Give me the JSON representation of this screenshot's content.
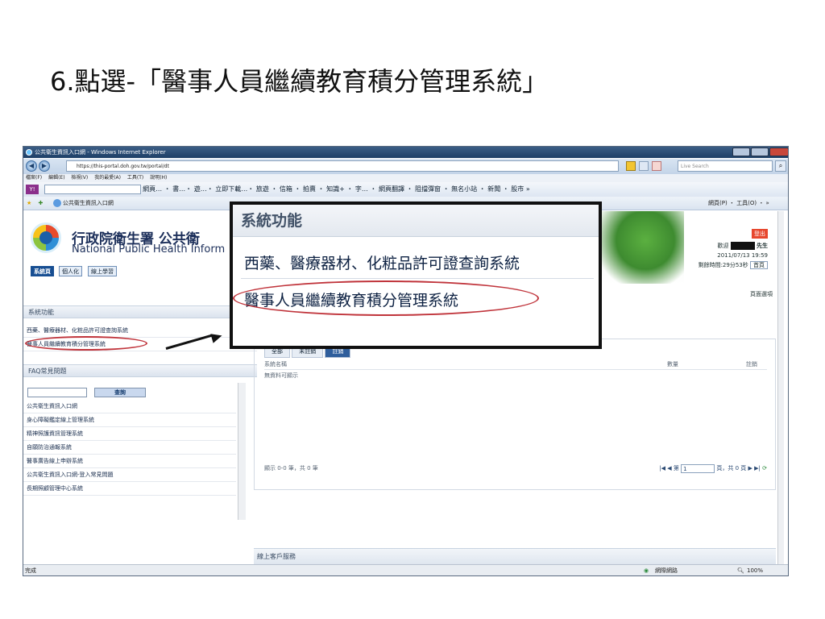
{
  "slide": {
    "title": "6.點選-「醫事人員繼續教育積分管理系統」"
  },
  "browser": {
    "window_title": "公共衛生資訊入口網 - Windows Internet Explorer",
    "url": "https://this-portal.doh.gov.tw/portal/dt",
    "search_placeholder": "Live Search",
    "menu": [
      "檔案(F)",
      "編輯(E)",
      "檢視(V)",
      "我的最愛(A)",
      "工具(T)",
      "說明(H)"
    ],
    "toolbar2_text": "網頁… ・ 書…・ 遊…・ 立即下載…・ 旅遊 ・ 信箱 ・ 拍賣 ・ 知識+ ・ 字… ・ 網頁翻譯 ・ 阻擋彈窗 ・ 無名小站 ・ 新聞 ・ 股市 »",
    "tab_label": "公共衛生資訊入口網",
    "tab_tools": "網頁(P) ・ 工具(O) ・ »",
    "status_left": "完成",
    "status_zone": "網際網路",
    "status_zoom": "100%"
  },
  "site": {
    "name_zh": "行政院衛生署 公共衛",
    "name_en": "National Public Health Inform",
    "tabs": [
      "系統頁",
      "個人化",
      "線上學習"
    ],
    "logout": "登出",
    "welcome": "歡迎",
    "user_suffix": "先生",
    "datetime": "2011/07/13 19:59",
    "remaining": "剩餘時間:29分53秒",
    "home": "首頁",
    "page_options": "頁面選項"
  },
  "sidebar": {
    "sys_title": "系統功能",
    "sys_items": [
      "西藥、醫療器材、化粧品許可證查詢系統",
      "醫事人員繼續教育積分管理系統"
    ],
    "faq_title": "FAQ常見問題",
    "faq_button": "查詢",
    "faq_items": [
      "公共衛生資訊入口網",
      "身心障礙鑑定線上管理系統",
      "精神照護資訊管理系統",
      "自願防治通報系統",
      "醫事廣告線上申辦系統",
      "公共衛生資訊入口網-登入常見問題",
      "長期照顧管理中心系統"
    ]
  },
  "main": {
    "tabs": [
      "全部",
      "未註銷",
      "註銷"
    ],
    "col_name": "系統名稱",
    "col_qty": "數量",
    "col_cancel": "註銷",
    "empty": "無資料可顯示",
    "footer": "顯示 0-0 筆，共 0 筆",
    "page_prefix": "第",
    "page_value": "1",
    "page_suffix": "頁，共 0 頁",
    "service_title": "線上客戶服務"
  },
  "callout": {
    "title": "系統功能",
    "item1": "西藥、醫療器材、化粧品許可證查詢系統",
    "item2": "醫事人員繼續教育積分管理系統"
  }
}
